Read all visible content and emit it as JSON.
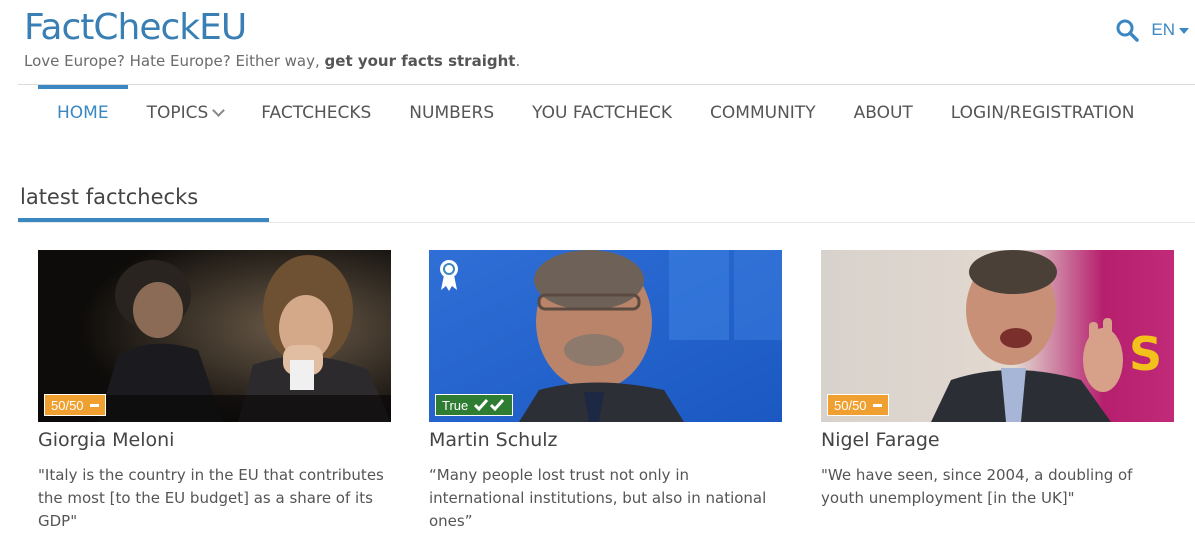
{
  "header": {
    "logo_part1": "FactChec",
    "logo_part2": "k",
    "logo_part3": "EU",
    "tagline_prefix": "Love Europe? Hate Europe? Either way, ",
    "tagline_bold": "get your facts straight",
    "tagline_suffix": ".",
    "language": "EN",
    "search_icon": "search-icon"
  },
  "nav": {
    "items": [
      {
        "label": "HOME",
        "active": true
      },
      {
        "label": "TOPICS",
        "has_dropdown": true
      },
      {
        "label": "FACTCHECKS"
      },
      {
        "label": "NUMBERS"
      },
      {
        "label": "YOU FACTCHECK"
      },
      {
        "label": "COMMUNITY"
      },
      {
        "label": "ABOUT"
      },
      {
        "label": "LOGIN/REGISTRATION"
      }
    ]
  },
  "section": {
    "title": "latest factchecks"
  },
  "cards": [
    {
      "name": "Giorgia Meloni",
      "badge": "50/50",
      "badge_color": "#f0a030",
      "quote": "\"Italy is the country in the EU that contributes the most [to the EU budget] as a share of its GDP\""
    },
    {
      "name": "Martin Schulz",
      "badge": "True",
      "badge_color": "#2e7d32",
      "award_icon": "award-ribbon-icon",
      "quote": "“Many people lost trust not only in international institutions, but also in national ones”"
    },
    {
      "name": "Nigel Farage",
      "badge": "50/50",
      "badge_color": "#f0a030",
      "quote": "\"We have seen, since 2004, a doubling of youth unemployment [in the UK]\""
    }
  ],
  "colors": {
    "brand_blue": "#3a87c2",
    "rating_half": "#f0a030",
    "rating_true": "#2e7d32"
  }
}
